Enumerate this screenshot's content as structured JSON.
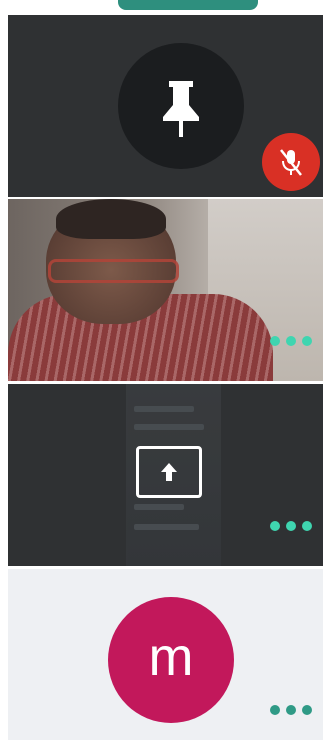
{
  "colors": {
    "accent_top_pill": "#2e8f7e",
    "tile_dark": "#2f3133",
    "mic_off_red": "#d93025",
    "dots_teal": "#3fd5b0",
    "avatar_magenta": "#c2185b",
    "bottom_tile_bg": "#eef0f3"
  },
  "icons": {
    "top": "pin-icon",
    "mic": "mic-off-icon",
    "share": "present-screen-icon",
    "more": "more-options-icon"
  },
  "tiles": [
    {
      "id": "pinned",
      "type": "pin"
    },
    {
      "id": "camera",
      "type": "video"
    },
    {
      "id": "presentation",
      "type": "screen-share"
    },
    {
      "id": "participant",
      "type": "avatar",
      "avatar_letter": "m"
    }
  ]
}
